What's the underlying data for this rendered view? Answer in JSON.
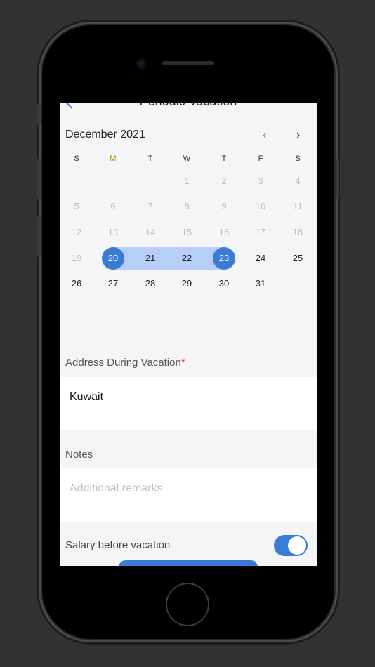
{
  "nav": {
    "title": "Periodic Vacation"
  },
  "calendar": {
    "month_label": "December 2021",
    "prev_icon": "‹",
    "next_icon": "›",
    "weekdays": [
      "S",
      "M",
      "T",
      "W",
      "T",
      "F",
      "S"
    ],
    "rows": [
      [
        "",
        "",
        "",
        "1",
        "2",
        "3",
        "4"
      ],
      [
        "5",
        "6",
        "7",
        "8",
        "9",
        "10",
        "11"
      ],
      [
        "12",
        "13",
        "14",
        "15",
        "16",
        "17",
        "18"
      ],
      [
        "19",
        "20",
        "21",
        "22",
        "23",
        "24",
        "25"
      ],
      [
        "26",
        "27",
        "28",
        "29",
        "30",
        "31",
        ""
      ]
    ],
    "range_start": "20",
    "range_end": "23",
    "disabled_through": "19",
    "accent_color": "#3a7bd5",
    "range_color": "#b7cff8"
  },
  "address": {
    "label": "Address During Vacation",
    "required_mark": "*",
    "value": "Kuwait"
  },
  "notes": {
    "label": "Notes",
    "placeholder": "Additional remarks"
  },
  "salary": {
    "label": "Salary before vacation",
    "enabled": true
  }
}
